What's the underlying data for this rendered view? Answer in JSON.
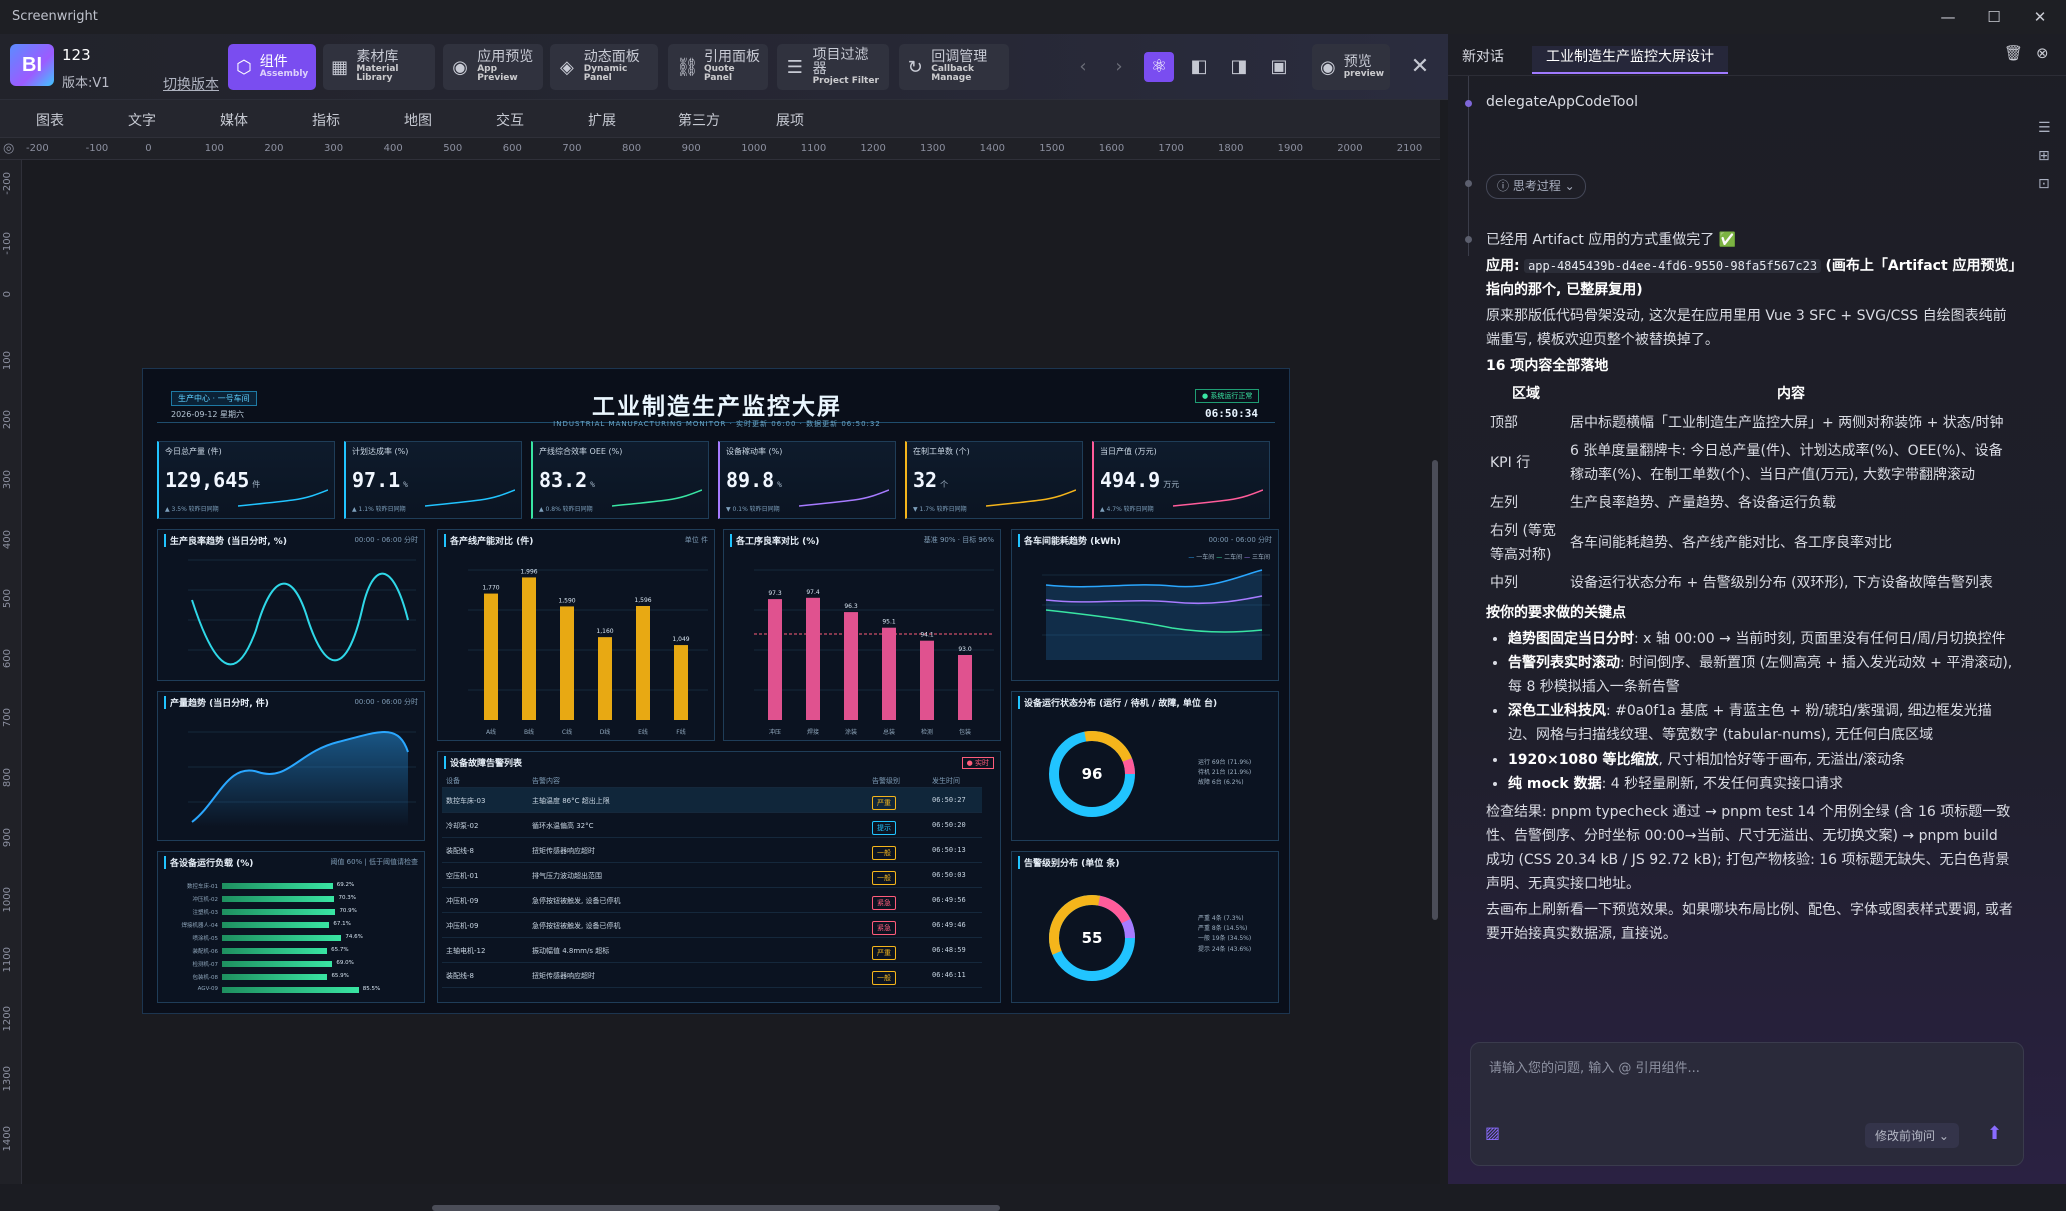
{
  "app": {
    "title": "Screenwright",
    "controls": [
      "—",
      "☐",
      "✕"
    ]
  },
  "header": {
    "logo": "BI",
    "project": "123",
    "version": "版本:V1",
    "switch_version": "切换版本"
  },
  "toolbar": [
    {
      "label": "组件",
      "sub": "Assembly",
      "icon": "⬡",
      "active": true
    },
    {
      "label": "素材库",
      "sub": "Material Library",
      "icon": "▦"
    },
    {
      "label": "应用预览",
      "sub": "App Preview",
      "icon": "◉"
    },
    {
      "label": "动态面板",
      "sub": "Dynamic Panel",
      "icon": "◈"
    },
    {
      "label": "引用面板",
      "sub": "Quote Panel",
      "icon": "⛓"
    },
    {
      "label": "项目过滤器",
      "sub": "Project Filter",
      "icon": "☰"
    },
    {
      "label": "回调管理",
      "sub": "Callback Manage",
      "icon": "↻"
    }
  ],
  "preview": {
    "label": "预览",
    "sub": "preview"
  },
  "categories": [
    "图表",
    "文字",
    "媒体",
    "指标",
    "地图",
    "交互",
    "扩展",
    "第三方",
    "展项"
  ],
  "ruler_h": [
    "-200",
    "-100",
    "0",
    "100",
    "200",
    "300",
    "400",
    "500",
    "600",
    "700",
    "800",
    "900",
    "1000",
    "1100",
    "1200",
    "1300",
    "1400",
    "1500",
    "1600",
    "1700",
    "1800",
    "1900",
    "2000",
    "2100"
  ],
  "ruler_v": [
    "-200",
    "-100",
    "0",
    "100",
    "200",
    "300",
    "400",
    "500",
    "600",
    "700",
    "800",
    "900",
    "1000",
    "1100",
    "1200",
    "1300",
    "1400"
  ],
  "dashboard": {
    "title": "工业制造生产监控大屏",
    "subtitle": "INDUSTRIAL MANUFACTURING MONITOR · 实时更新 06:00 · 数据更新 06:50:32",
    "location": "生产中心 · 一号车间",
    "date": "2026-09-12 星期六",
    "status": "● 系统运行正常",
    "time": "06:50:34",
    "kpis": [
      {
        "name": "今日总产量 (件)",
        "value": "129,645",
        "unit": "件",
        "delta": "▲ 3.5% 较昨日同期",
        "color": "#21c4ff"
      },
      {
        "name": "计划达成率 (%)",
        "value": "97.1",
        "unit": "%",
        "delta": "▲ 1.1% 较昨日同期",
        "color": "#21c4ff"
      },
      {
        "name": "产线综合效率 OEE (%)",
        "value": "83.2",
        "unit": "%",
        "delta": "▲ 0.8% 较昨日同期",
        "color": "#39e5a3"
      },
      {
        "name": "设备稼动率 (%)",
        "value": "89.8",
        "unit": "%",
        "delta": "▼ 0.1% 较昨日同期",
        "color": "#a77bff"
      },
      {
        "name": "在制工单数 (个)",
        "value": "32",
        "unit": "个",
        "delta": "▼ 1.7% 较昨日同期",
        "color": "#f5b51b"
      },
      {
        "name": "当日产值 (万元)",
        "value": "494.9",
        "unit": "万元",
        "delta": "▲ 4.7% 较昨日同期",
        "color": "#ff5c9a"
      }
    ],
    "panels": {
      "yield_trend": "生产良率趋势 (当日分时, %)",
      "yield_range": "00:00 - 06:00 分时",
      "output_trend": "产量趋势 (当日分时, 件)",
      "output_range": "00:00 - 06:00 分时",
      "line_output": "各产线产能对比 (件)",
      "line_unit": "单位 件",
      "process_yield": "各工序良率对比 (%)",
      "process_note": "基准 90% · 目标 96%",
      "energy": "各车间能耗趋势 (kWh)",
      "energy_range": "00:00 - 06:00 分时",
      "energy_legend": [
        "一车间",
        "二车间",
        "三车间"
      ],
      "load": "各设备运行负载 (%)",
      "load_note": "阈值 60% | 低于阈值请检查",
      "alarms": "设备故障告警列表",
      "alarms_badge": "● 实时",
      "status_dist": "设备运行状态分布 (运行 / 待机 / 故障, 单位 台)",
      "status_total": "96",
      "status_legend": [
        "运行 69台 (71.9%)",
        "待机 21台 (21.9%)",
        "故障 6台 (6.2%)"
      ],
      "level_dist": "告警级别分布 (单位 条)",
      "level_total": "55",
      "level_legend": [
        "严重 4条 (7.3%)",
        "严重 8条 (14.5%)",
        "一般 19条 (34.5%)",
        "提示 24条 (43.6%)"
      ]
    },
    "line_output_labels": [
      "1,770",
      "1,996",
      "1,590",
      "1,160",
      "1,596",
      "1,049"
    ],
    "line_output_x": [
      "A线",
      "B线",
      "C线",
      "D线",
      "E线",
      "F线"
    ],
    "process_labels": [
      "97.3",
      "97.4",
      "96.3",
      "95.1",
      "94.1",
      "93.0"
    ],
    "process_x": [
      "冲压",
      "焊接",
      "涂装",
      "总装",
      "检测",
      "包装"
    ],
    "load_labels": [
      "69.2%",
      "70.3%",
      "70.9%",
      "67.1%",
      "74.6%",
      "65.7%",
      "69.0%",
      "65.9%",
      "85.5%"
    ],
    "load_names": [
      "数控车床-01",
      "冲压机-02",
      "注塑机-03",
      "焊接机器人-04",
      "喷涂机-05",
      "装配机-06",
      "检测机-07",
      "包装机-08",
      "AGV-09"
    ],
    "alarm_header": [
      "设备",
      "告警内容",
      "告警级别",
      "发生时间"
    ],
    "alarm_rows": [
      [
        "数控车床-03",
        "主轴温度 86°C 超出上限",
        "严重",
        "06:50:27"
      ],
      [
        "冷却泵-02",
        "循环水温偏高 32°C",
        "提示",
        "06:50:20"
      ],
      [
        "装配线-8",
        "扭矩传感器响应超时",
        "一般",
        "06:50:13"
      ],
      [
        "空压机-01",
        "排气压力波动超出范围",
        "一般",
        "06:50:03"
      ],
      [
        "冲压机-09",
        "急停按钮被触发, 设备已停机",
        "紧急",
        "06:49:56"
      ],
      [
        "冲压机-09",
        "急停按钮被触发, 设备已停机",
        "紧急",
        "06:49:46"
      ],
      [
        "主轴电机-12",
        "振动幅值 4.8mm/s 超标",
        "严重",
        "06:48:59"
      ],
      [
        "装配线-8",
        "扭矩传感器响应超时",
        "一般",
        "06:46:11"
      ]
    ]
  },
  "chat": {
    "tabs": [
      "新对话",
      "工业制造生产监控大屏设计"
    ],
    "tool": "delegateAppCodeTool",
    "thinking": "思考过程",
    "done": "已经用 Artifact 应用的方式重做完了 ✅",
    "app_label": "应用:",
    "app_id": "app-4845439b-d4ee-4fd6-9550-98fa5f567c23",
    "app_note": "(画布上「Artifact 应用预览」指向的那个, 已整屏复用)",
    "para1": "原来那版低代码骨架没动, 这次是在应用里用 Vue 3 SFC + SVG/CSS 自绘图表纯前端重写, 模板欢迎页整个被替换掉了。",
    "section1": "16 项内容全部落地",
    "table_head": [
      "区域",
      "内容"
    ],
    "table_rows": [
      [
        "顶部",
        "居中标题横幅「工业制造生产监控大屏」+ 两侧对称装饰 + 状态/时钟"
      ],
      [
        "KPI 行",
        "6 张单度量翻牌卡: 今日总产量(件)、计划达成率(%)、OEE(%)、设备稼动率(%)、在制工单数(个)、当日产值(万元), 大数字带翻牌滚动"
      ],
      [
        "左列",
        "生产良率趋势、产量趋势、各设备运行负载"
      ],
      [
        "右列 (等宽等高对称)",
        "各车间能耗趋势、各产线产能对比、各工序良率对比"
      ],
      [
        "中列",
        "设备运行状态分布 + 告警级别分布 (双环形), 下方设备故障告警列表"
      ]
    ],
    "section2": "按你的要求做的关键点",
    "points": [
      {
        "b": "趋势图固定当日分时",
        "t": ": x 轴 00:00 → 当前时刻, 页面里没有任何日/周/月切换控件"
      },
      {
        "b": "告警列表实时滚动",
        "t": ": 时间倒序、最新置顶 (左侧高亮 + 插入发光动效 + 平滑滚动), 每 8 秒模拟插入一条新告警"
      },
      {
        "b": "深色工业科技风",
        "t": ": #0a0f1a 基底 + 青蓝主色 + 粉/琥珀/紫强调, 细边框发光描边、网格与扫描线纹理、等宽数字 (tabular-nums), 无任何白底区域"
      },
      {
        "b": "1920×1080 等比缩放",
        "t": ", 尺寸相加恰好等于画布, 无溢出/滚动条"
      },
      {
        "b": "纯 mock 数据",
        "t": ": 4 秒轻量刷新, 不发任何真实接口请求"
      }
    ],
    "check": "检查结果: pnpm typecheck 通过 → pnpm test 14 个用例全绿 (含 16 项标题一致性、告警倒序、分时坐标 00:00→当前、尺寸无溢出、无切换文案) → pnpm build 成功 (CSS 20.34 kB / JS 92.72 kB); 打包产物核验: 16 项标题无缺失、无白色背景声明、无真实接口地址。",
    "closing": "去画布上刷新看一下预览效果。如果哪块布局比例、配色、字体或图表样式要调, 或者要开始接真实数据源, 直接说。",
    "placeholder": "请输入您的问题, 输入 @ 引用组件...",
    "mode": "修改前询问 ⌄"
  }
}
